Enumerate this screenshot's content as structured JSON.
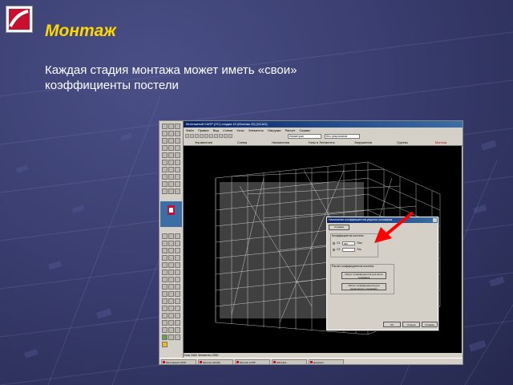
{
  "slide": {
    "title": "Монтаж",
    "subtitle": "Каждая стадия монтажа может иметь «свои» коэффициенты постели",
    "colors": {
      "title": "#ffd700",
      "subtitle": "#ffffff",
      "background": "#3a3e70"
    }
  },
  "logo": {
    "icon": "brand-logo"
  },
  "screenshot": {
    "window_title": "Монтажный САПР (ПС) стадия 10 (Монтаж 10) (SCAD)",
    "menu": [
      "Файл",
      "Правка",
      "Вид",
      "Схема",
      "Узлы",
      "Элементы",
      "Нагрузки",
      "Расчет",
      "Сервис"
    ],
    "combo_view": "Изометрия",
    "combo_mode": "Без результатов",
    "tabs": [
      "Управление",
      "Схема",
      "Назначения",
      "Узлы и Элементы",
      "Загружения",
      "Группы",
      "Монтаж"
    ],
    "viewport_icon": "3d-wireframe-building",
    "taskbar": [
      "Монтажный САПР",
      "Монтаж (SCAD)",
      "Монтаж САПР",
      "Windows",
      "Документ",
      "Пуск"
    ],
    "status": "Узлы 3460 Элементы 2530"
  },
  "dialog": {
    "title": "Назначение коэффициентов упругого основания",
    "field_label": "Коэффициенты постели",
    "c1_label": "C1",
    "c1_value": "850",
    "c1_unit": "Т/м³",
    "c2_label": "C2",
    "c2_value": "",
    "c2_unit": "Т/м",
    "calc_group_label": "Расчет коэффициентов постели",
    "btn_calc_all": "Расчет коэффициентов для всего основания",
    "btn_calc_sel": "Расчет коэффициентов для выделенного основания",
    "ok": "OK",
    "cancel": "Отмена",
    "help": "Справка"
  },
  "arrow": {
    "color": "#ff0000",
    "icon": "red-arrow"
  }
}
